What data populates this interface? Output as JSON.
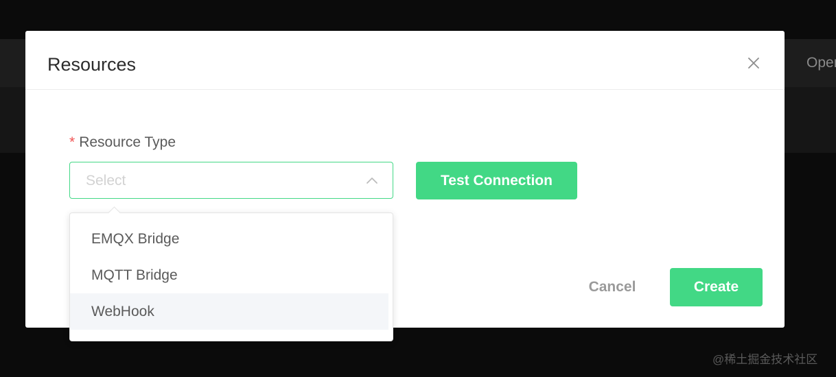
{
  "background": {
    "header_partial_label": "Oper",
    "watermark": "@稀土掘金技术社区"
  },
  "modal": {
    "title": "Resources",
    "close_icon": "close-icon",
    "form": {
      "resource_type": {
        "required_mark": "*",
        "label": "Resource Type",
        "placeholder": "Select",
        "chevron_icon": "chevron-up-icon",
        "options": [
          {
            "label": "EMQX Bridge"
          },
          {
            "label": "MQTT Bridge"
          },
          {
            "label": "WebHook"
          }
        ],
        "highlighted_option": "WebHook"
      }
    },
    "buttons": {
      "test_connection": "Test Connection",
      "cancel": "Cancel",
      "create": "Create"
    }
  },
  "colors": {
    "accent": "#42d885",
    "required": "#f05454",
    "overlay": "#0b0b0b"
  }
}
